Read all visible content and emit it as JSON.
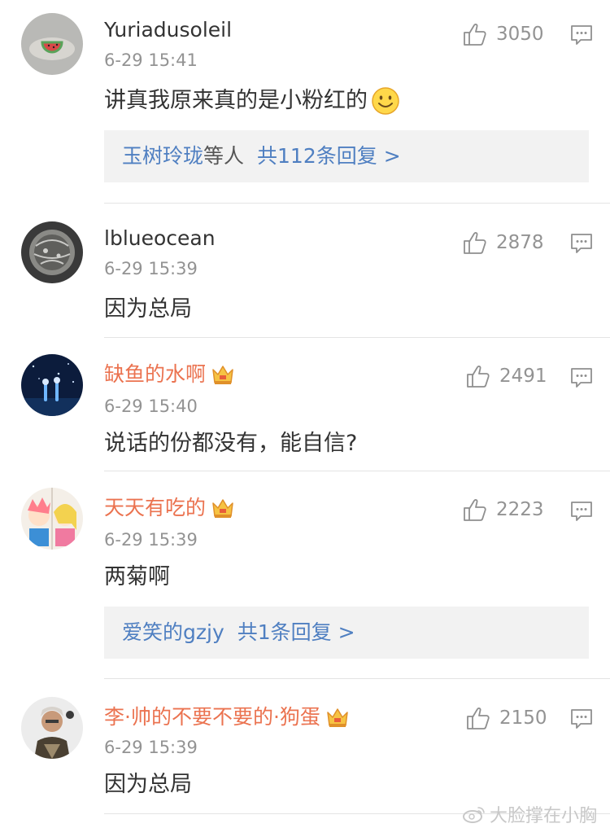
{
  "comments": [
    {
      "username": "Yuriadusoleil",
      "time": "6-29 15:41",
      "text": "讲真我原来真的是小粉红的",
      "likes": "3050",
      "reply": {
        "names": "玉树玲珑",
        "suffix": "等人",
        "count": "共112条回复 >"
      }
    },
    {
      "username": "lblueocean",
      "time": "6-29 15:39",
      "text": "因为总局",
      "likes": "2878"
    },
    {
      "username": "缺鱼的水啊",
      "time": "6-29 15:40",
      "text": "说话的份都没有，能自信?",
      "likes": "2491"
    },
    {
      "username": "天天有吃的",
      "time": "6-29 15:39",
      "text": "两菊啊",
      "likes": "2223",
      "reply": {
        "names": "爱笑的gzjy",
        "count": "共1条回复 >"
      }
    },
    {
      "username": "李·帅的不要不要的·狗蛋",
      "time": "6-29 15:39",
      "text": "因为总局",
      "likes": "2150"
    }
  ],
  "watermark": "大脸撑在小胸",
  "colors": {
    "vip_name": "#eb7350",
    "link_blue": "#4f7fc1",
    "meta_gray": "#939393",
    "reply_bg": "#f2f2f2"
  },
  "icons": [
    "thumbs-up-icon",
    "reply-comment-icon",
    "crown-vip-icon",
    "smile-emoji",
    "weibo-logo-icon"
  ]
}
